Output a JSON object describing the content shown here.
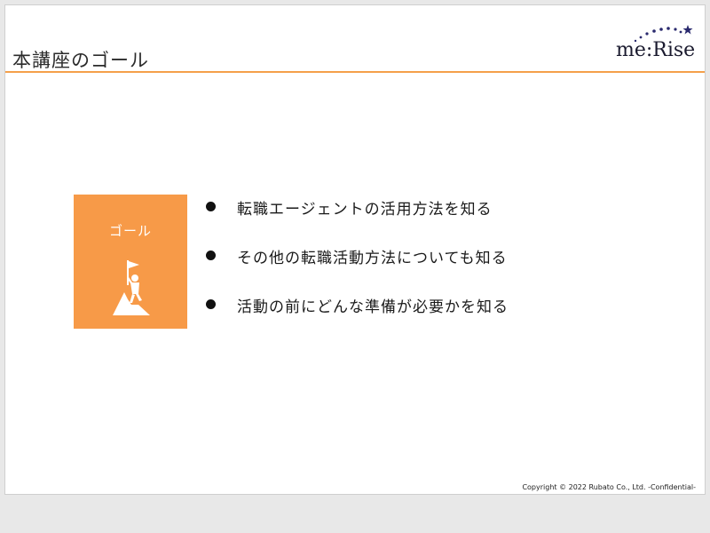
{
  "slide": {
    "title": "本講座のゴール",
    "logo_text": "me:Rise",
    "goal_box": {
      "label": "ゴール",
      "icon": "climber-flag-icon",
      "color": "#f79a48"
    },
    "bullets": [
      "転職エージェントの活用方法を知る",
      "その他の転職活動方法についても知る",
      "活動の前にどんな準備が必要かを知る"
    ],
    "copyright": "Copyright © 2022 Rubato Co., Ltd. -Confidential-",
    "accent_color": "#f5a04a"
  }
}
